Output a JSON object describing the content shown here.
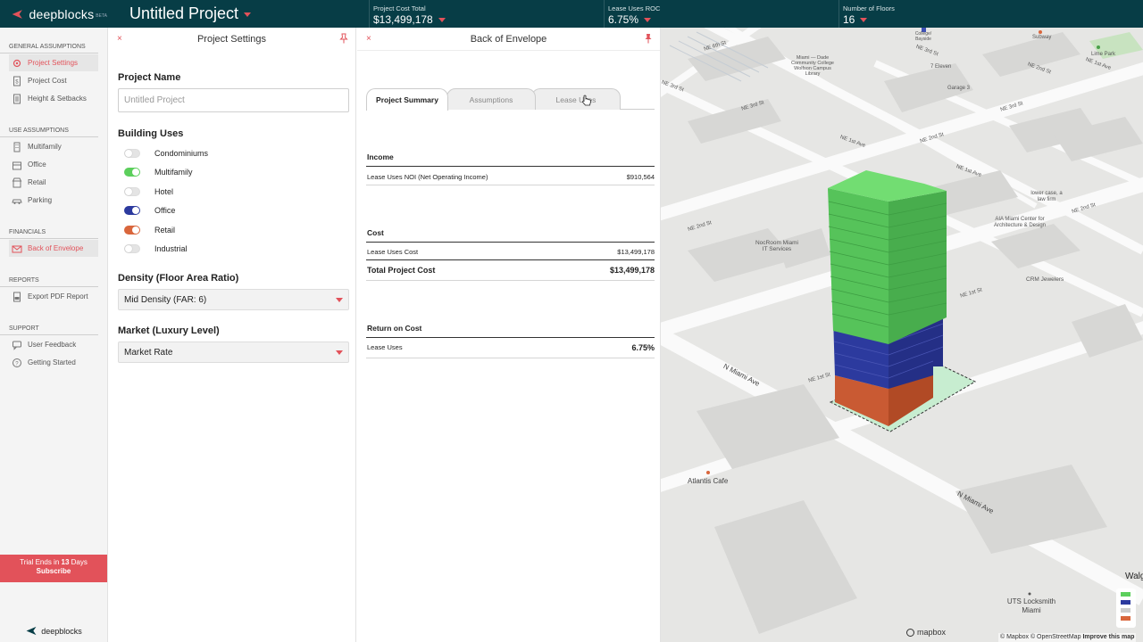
{
  "header": {
    "brand": "deepblocks",
    "brand_badge": "BETA",
    "project_title": "Untitled Project",
    "stats": [
      {
        "label": "Project Cost Total",
        "value": "$13,499,178"
      },
      {
        "label": "Lease Uses ROC",
        "value": "6.75%"
      },
      {
        "label": "Number of Floors",
        "value": "16"
      }
    ]
  },
  "sidebar": {
    "sections": [
      {
        "title": "GENERAL ASSUMPTIONS",
        "items": [
          {
            "label": "Project Settings",
            "icon": "gear-icon",
            "active": true
          },
          {
            "label": "Project Cost",
            "icon": "dollar-doc-icon",
            "active": false
          },
          {
            "label": "Height & Setbacks",
            "icon": "ruler-doc-icon",
            "active": false
          }
        ]
      },
      {
        "title": "USE ASSUMPTIONS",
        "items": [
          {
            "label": "Multifamily",
            "icon": "building-icon",
            "active": false
          },
          {
            "label": "Office",
            "icon": "office-icon",
            "active": false
          },
          {
            "label": "Retail",
            "icon": "store-icon",
            "active": false
          },
          {
            "label": "Parking",
            "icon": "car-icon",
            "active": false
          }
        ]
      },
      {
        "title": "FINANCIALS",
        "items": [
          {
            "label": "Back of Envelope",
            "icon": "envelope-icon",
            "active": true
          }
        ]
      },
      {
        "title": "REPORTS",
        "items": [
          {
            "label": "Export PDF Report",
            "icon": "pdf-icon",
            "active": false
          }
        ]
      },
      {
        "title": "SUPPORT",
        "items": [
          {
            "label": "User Feedback",
            "icon": "chat-icon",
            "active": false
          },
          {
            "label": "Getting Started",
            "icon": "help-icon",
            "active": false
          }
        ]
      }
    ],
    "trial_prefix": "Trial Ends in",
    "trial_days": "13",
    "trial_suffix": "Days",
    "subscribe_label": "Subscribe",
    "footer_brand": "deepblocks"
  },
  "project_settings": {
    "title": "Project Settings",
    "close_label": "×",
    "name_label": "Project Name",
    "name_placeholder": "Untitled Project",
    "uses_label": "Building Uses",
    "uses": [
      {
        "label": "Condominiums",
        "on": false,
        "color": "#cccccc"
      },
      {
        "label": "Multifamily",
        "on": true,
        "color": "#5ccf5c"
      },
      {
        "label": "Hotel",
        "on": false,
        "color": "#cccccc"
      },
      {
        "label": "Office",
        "on": true,
        "color": "#2c3a9e"
      },
      {
        "label": "Retail",
        "on": true,
        "color": "#d9663c"
      },
      {
        "label": "Industrial",
        "on": false,
        "color": "#cccccc"
      }
    ],
    "density_label": "Density (Floor Area Ratio)",
    "density_value": "Mid Density (FAR: 6)",
    "market_label": "Market (Luxury Level)",
    "market_value": "Market Rate"
  },
  "back_of_envelope": {
    "title": "Back of Envelope",
    "close_label": "×",
    "tabs": [
      "Project Summary",
      "Assumptions",
      "Lease Uses"
    ],
    "income_title": "Income",
    "income_rows": [
      {
        "label": "Lease Uses NOI (Net Operating Income)",
        "value": "$910,564"
      }
    ],
    "cost_title": "Cost",
    "cost_rows": [
      {
        "label": "Lease Uses Cost",
        "value": "$13,499,178"
      }
    ],
    "cost_total": {
      "label": "Total Project Cost",
      "value": "$13,499,178"
    },
    "return_title": "Return on Cost",
    "return_rows": [
      {
        "label": "Lease Uses",
        "value": "6.75%"
      }
    ]
  },
  "map": {
    "street_labels": [
      "NE 6th St",
      "NE 3rd St",
      "NE 3rd St",
      "NE 3rd St",
      "NE 3rd St",
      "NE 2nd St",
      "NE 2nd St",
      "NE 1st Ave",
      "NE 1st Ave",
      "NE 2nd St",
      "NE 2nd St",
      "NE 1st St",
      "NE 1st St",
      "N Miami Ave",
      "N Miami Ave",
      "NE 1st Ave"
    ],
    "places": [
      "Miami — Dade Community College Wolfson Campus Library",
      "7 Eleven",
      "Garage 3",
      "Subway",
      "Lime Park",
      "College/ Bayside",
      "lower case, a law firm",
      "AIA Miami Center for Architecture & Design",
      "NocRoom Miami IT Services",
      "CRM Jewelers",
      "Atlantis Cafe",
      "UTS Locksmith Miami",
      "Walg"
    ],
    "attribution": "© Mapbox © OpenStreetMap",
    "improve_label": "Improve this map",
    "mapbox_label": "mapbox",
    "legend_colors": [
      "#5ccf5c",
      "#2c3a9e",
      "#cccccc",
      "#d9663c"
    ]
  }
}
